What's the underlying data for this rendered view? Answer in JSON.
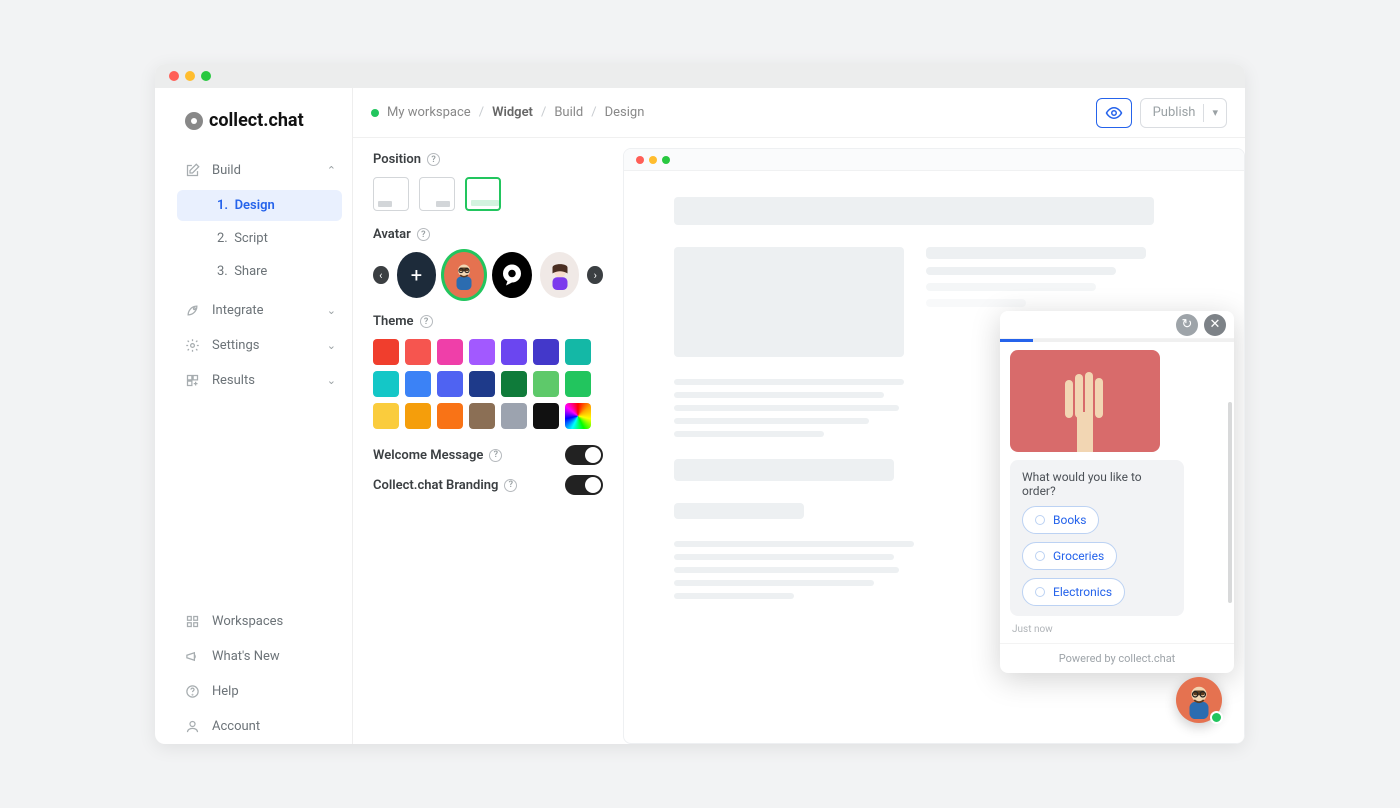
{
  "app": {
    "name": "collect.chat"
  },
  "sidebar": {
    "build": {
      "label": "Build",
      "expanded": true,
      "children": [
        {
          "num": "1.",
          "label": "Design",
          "active": true
        },
        {
          "num": "2.",
          "label": "Script"
        },
        {
          "num": "3.",
          "label": "Share"
        }
      ]
    },
    "integrate": {
      "label": "Integrate"
    },
    "settings": {
      "label": "Settings"
    },
    "results": {
      "label": "Results"
    },
    "workspaces": {
      "label": "Workspaces"
    },
    "whatsnew": {
      "label": "What's New"
    },
    "help": {
      "label": "Help"
    },
    "account": {
      "label": "Account"
    }
  },
  "breadcrumb": {
    "workspace": "My workspace",
    "item1": "Widget",
    "item2": "Build",
    "item3": "Design"
  },
  "topActions": {
    "publish": "Publish"
  },
  "design": {
    "positionLabel": "Position",
    "avatarLabel": "Avatar",
    "themeLabel": "Theme",
    "welcomeLabel": "Welcome Message",
    "brandingLabel": "Collect.chat Branding",
    "themeColors": [
      "#f03e2d",
      "#f6554f",
      "#ef3fa9",
      "#a259ff",
      "#6b46f0",
      "#4338ca",
      "#14b8a6",
      "#14c7c7",
      "#3b82f6",
      "#4f63f2",
      "#1e3a8a",
      "#0f7b3a",
      "#5ec96a",
      "#22c55e",
      "#facc3d",
      "#f59e0b",
      "#f97316",
      "#8b6f55",
      "#9ca3af",
      "#111111",
      "rainbow"
    ]
  },
  "chat": {
    "prompt": "What would you like to order?",
    "options": [
      "Books",
      "Groceries",
      "Electronics"
    ],
    "timestamp": "Just now",
    "powered": "Powered by collect.chat"
  }
}
